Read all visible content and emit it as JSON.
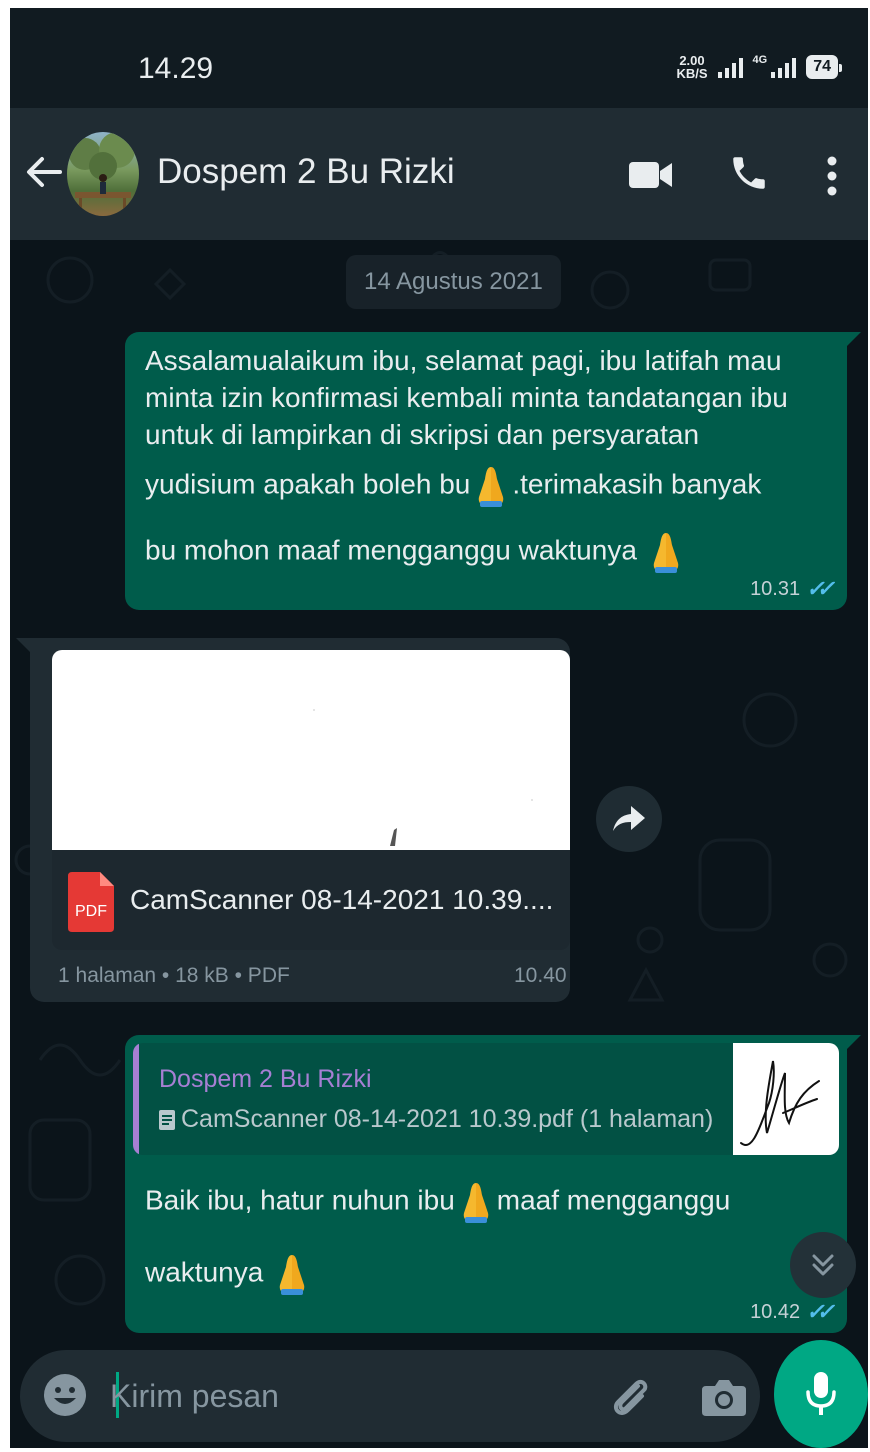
{
  "status_bar": {
    "time": "14.29",
    "speed_value": "2.00",
    "speed_unit": "KB/S",
    "network_label": "4G",
    "battery": "74"
  },
  "header": {
    "contact_name": "Dospem 2 Bu Rizki",
    "icons": [
      "back-arrow-icon",
      "video-call-icon",
      "phone-call-icon",
      "more-vert-icon"
    ]
  },
  "chat": {
    "date_chip": "14 Agustus 2021",
    "message1": {
      "line1": "Assalamualaikum ibu,  selamat pagi, ibu latifah mau",
      "line2": "minta izin konfirmasi kembali minta tandatangan ibu",
      "line3": "untuk di lampirkan di skripsi dan persyaratan",
      "line4a": "yudisium apakah boleh bu",
      "line4b": ".terimakasih banyak",
      "line5": "bu mohon maaf mengganggu waktunya",
      "time": "10.31",
      "ticks": "✓✓"
    },
    "document": {
      "file_name": "CamScanner 08-14-2021 10.39....",
      "pdf_label": "PDF",
      "info": "1 halaman • 18 kB • PDF",
      "time": "10.40"
    },
    "message2": {
      "quote_name": "Dospem 2 Bu Rizki",
      "quote_file": "CamScanner 08-14-2021 10.39.pdf (1 halaman)",
      "line1a": "Baik ibu, hatur nuhun ibu",
      "line1b": "maaf mengganggu",
      "line2": "waktunya",
      "time": "10.42",
      "ticks": "✓✓"
    }
  },
  "input": {
    "placeholder": "Kirim pesan",
    "value": ""
  },
  "colors": {
    "background": "#0b141a",
    "header": "#202c33",
    "outgoing_bubble": "#005c4b",
    "incoming_bubble": "#202c33",
    "accent": "#00a884",
    "read_ticks": "#53bdeb",
    "quote_name": "#a67fd3",
    "pdf_red": "#e53935"
  }
}
